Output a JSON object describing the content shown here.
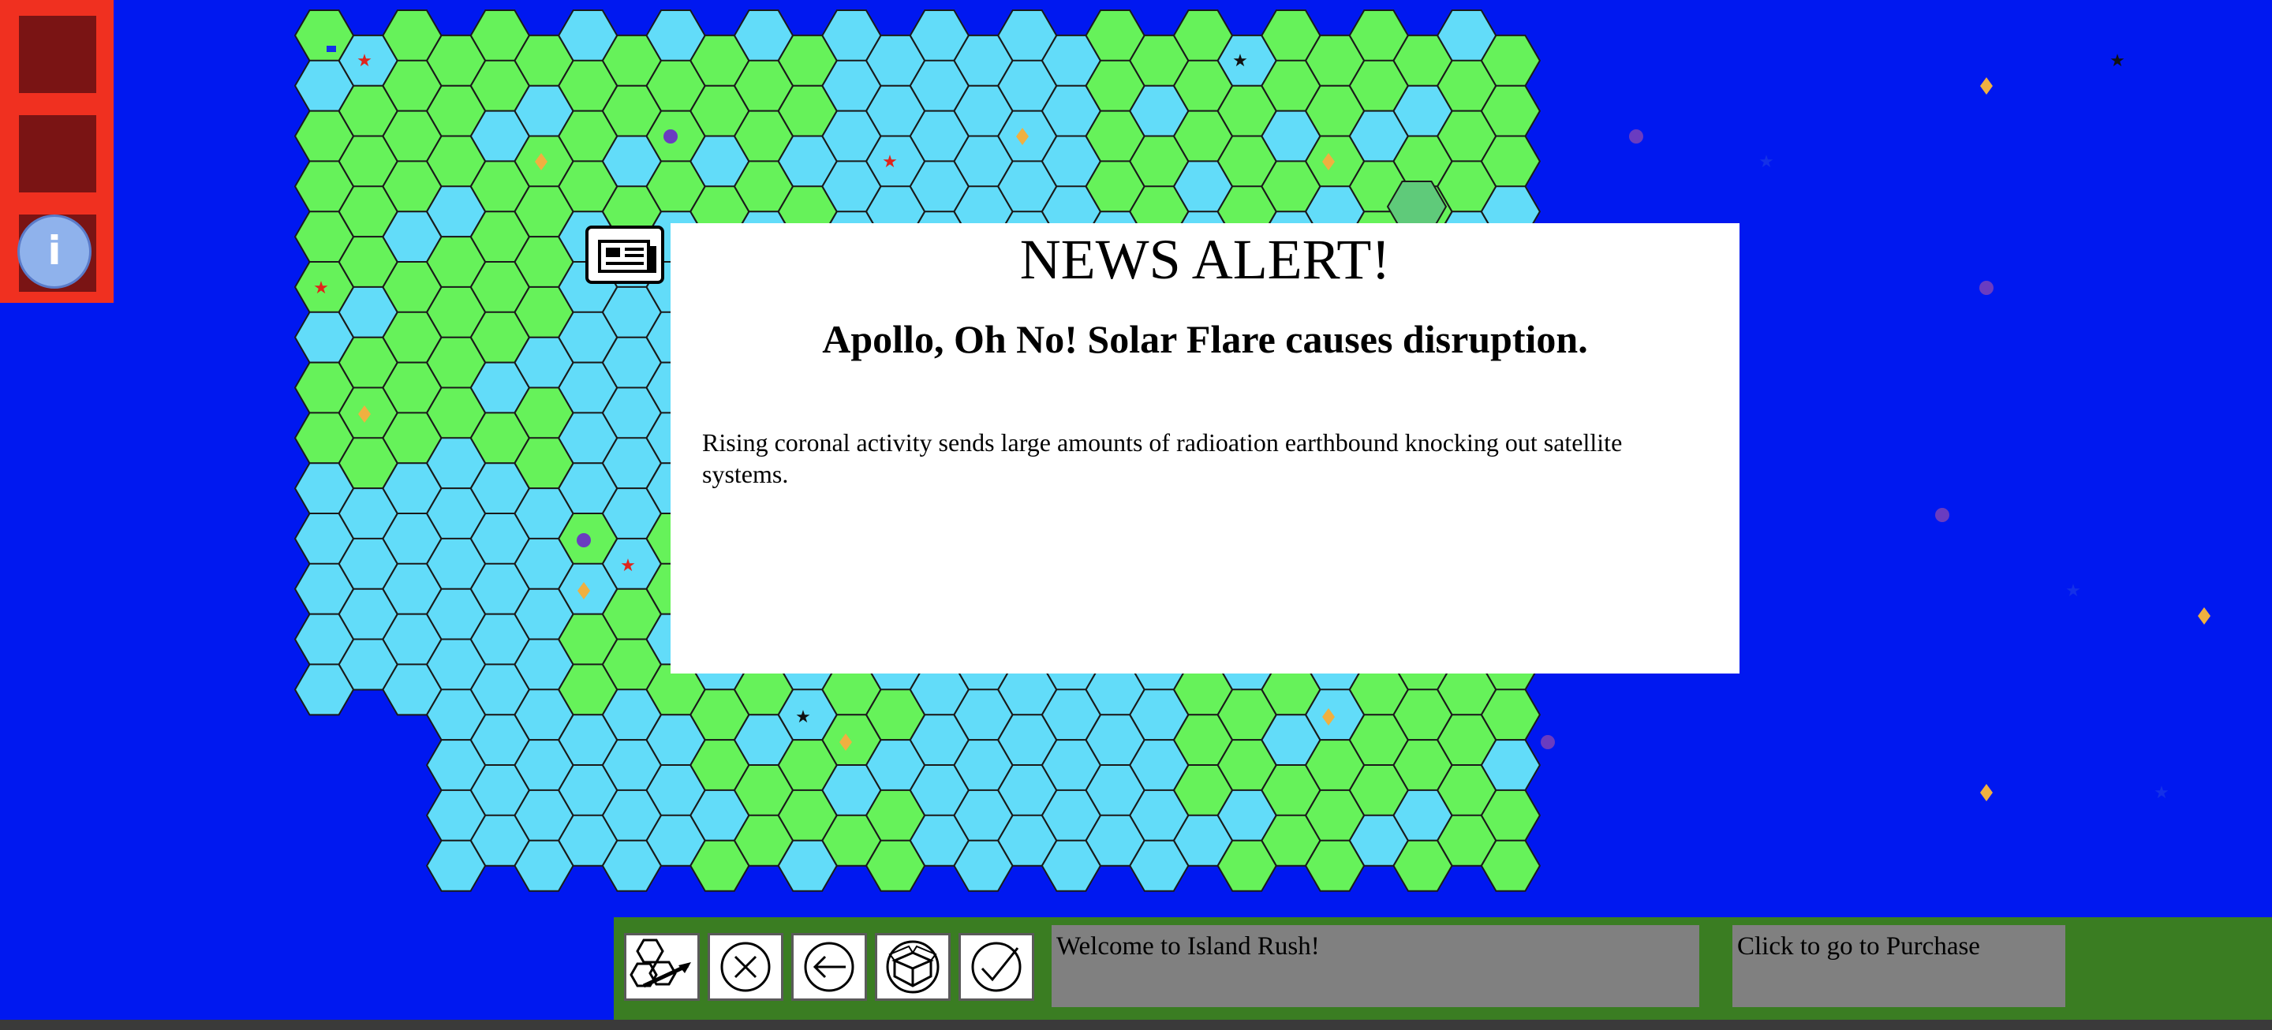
{
  "colors": {
    "ocean": "#0018f0",
    "land": "#66f25a",
    "water_hex": "#62dcf9",
    "dark_land": "#5fca7a",
    "sidebar": "#f03020",
    "sidebar_button": "#7a1414",
    "bottom_bar": "#3a7d22",
    "message_box": "#808080"
  },
  "sidebar": {
    "info_label": "i",
    "buttons": [
      "empty-slot",
      "empty-slot",
      "info-icon"
    ]
  },
  "popup": {
    "icon": "newspaper-icon",
    "title": "NEWS ALERT!",
    "headline": "Apollo, Oh No! Solar Flare causes disruption.",
    "body": "Rising coronal activity sends large amounts of radioation earthbound knocking out satellite systems."
  },
  "toolbar": {
    "buttons": [
      {
        "name": "move-hexes-button",
        "icon": "hex-arrow-icon"
      },
      {
        "name": "cancel-button",
        "icon": "close-circle-icon"
      },
      {
        "name": "undo-button",
        "icon": "back-arrow-icon"
      },
      {
        "name": "container-button",
        "icon": "box-icon"
      },
      {
        "name": "confirm-button",
        "icon": "check-circle-icon"
      }
    ],
    "status_message": "Welcome to Island Rush!",
    "purchase_label": "Click to go to Purchase"
  }
}
